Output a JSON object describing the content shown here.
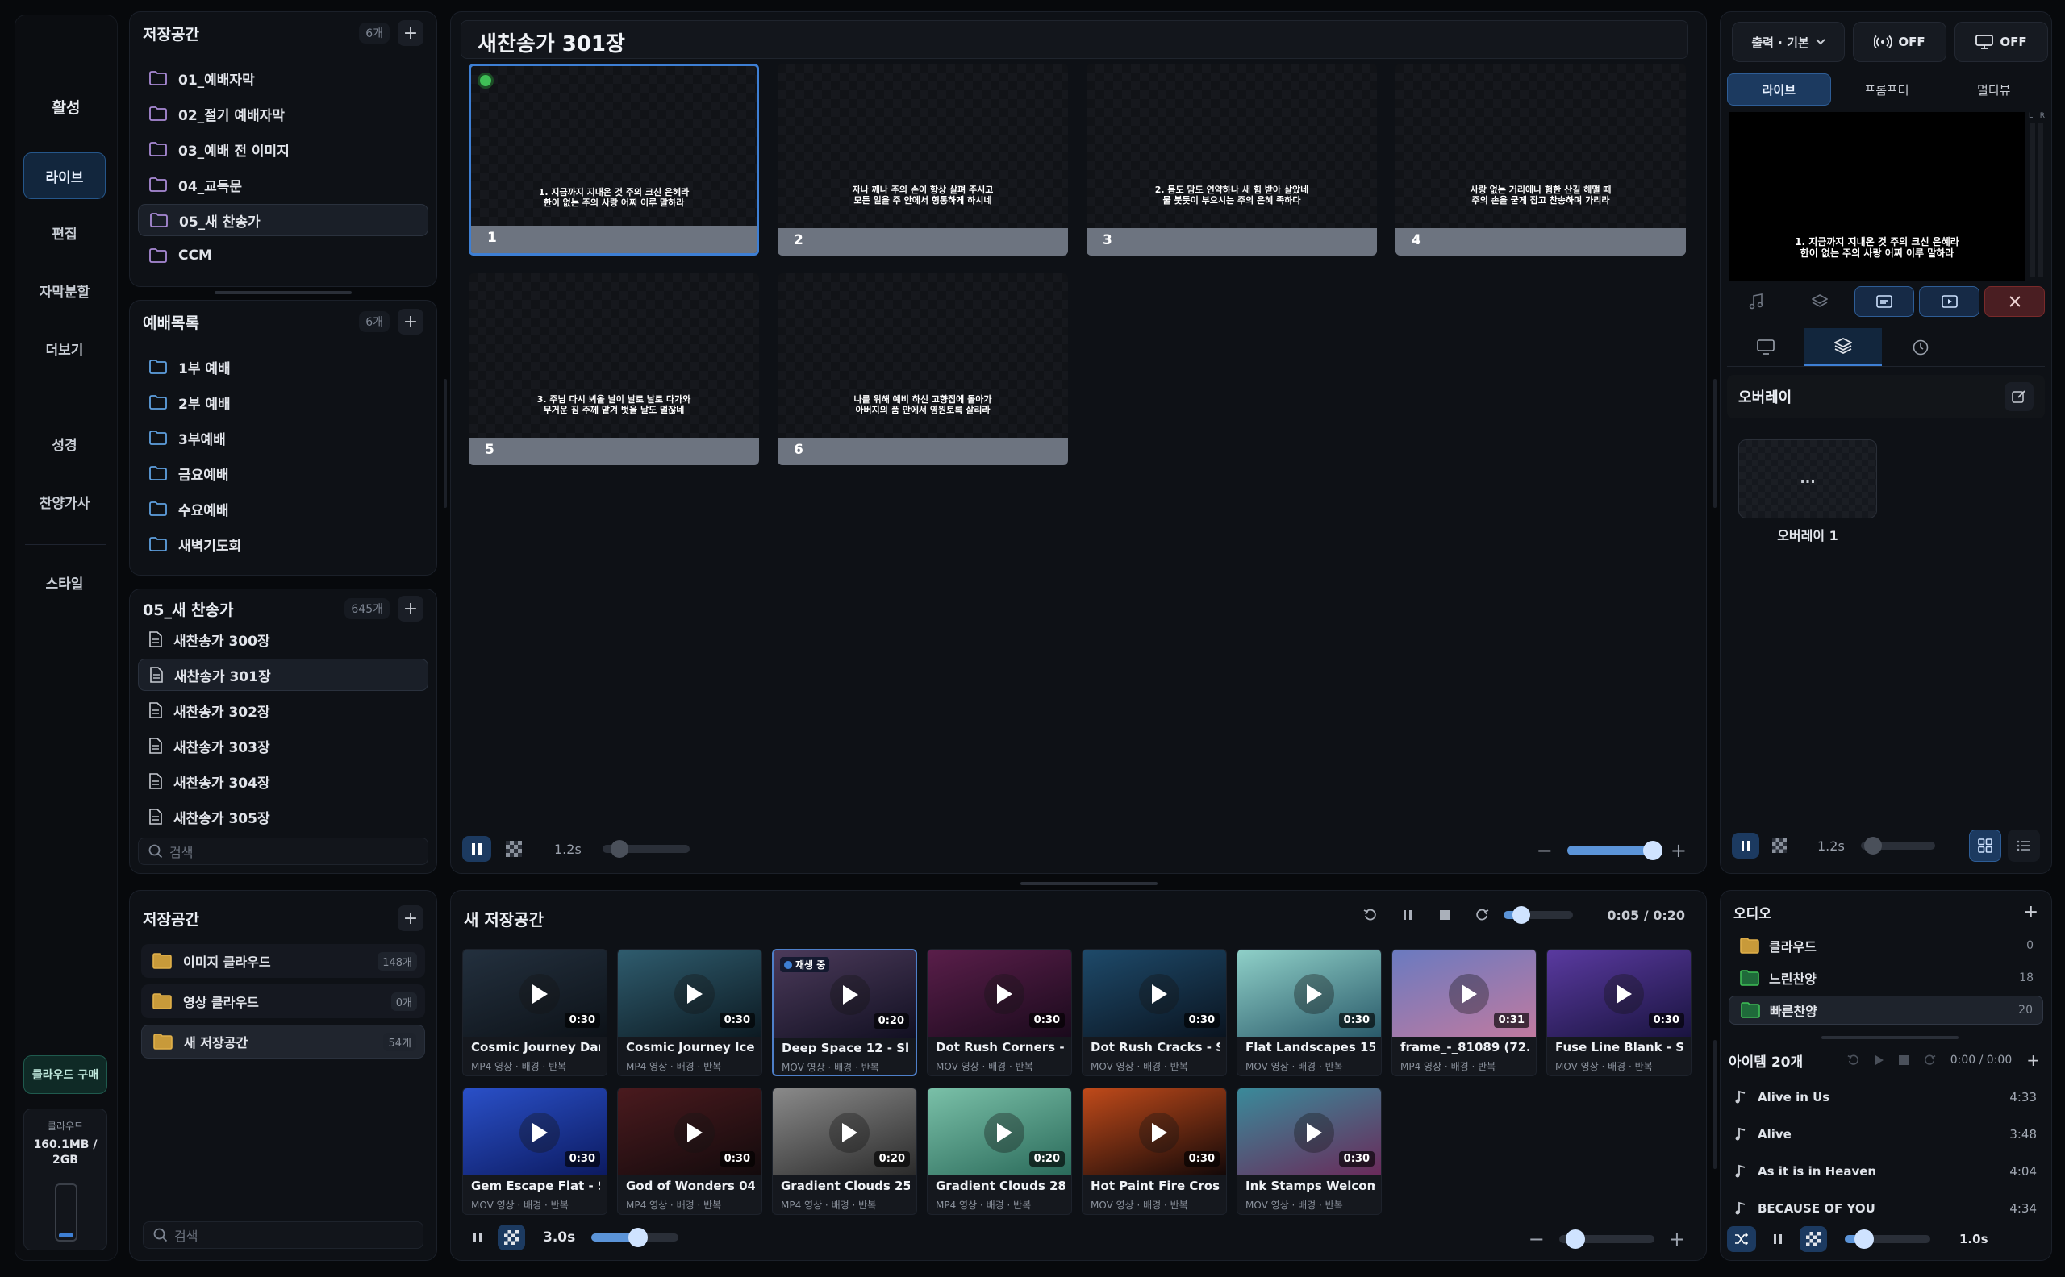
{
  "nav": {
    "section_title": "활성",
    "items": [
      "라이브",
      "편집",
      "자막분할",
      "더보기",
      "성경",
      "찬양가사",
      "스타일"
    ],
    "cloud_buy": "클라우드 구매",
    "cloud_usage_label": "클라우드",
    "cloud_usage_value": "160.1MB / 2GB",
    "cloud_fill": 0.08
  },
  "storage": {
    "title": "저장공간",
    "count": "6개",
    "folders": [
      "01_예배자막",
      "02_절기 예배자막",
      "03_예배 전 이미지",
      "04_교독문",
      "05_새 찬송가",
      "CCM"
    ],
    "selected": 4
  },
  "services": {
    "title": "예배목록",
    "count": "6개",
    "folders": [
      "1부 예배",
      "2부 예배",
      "3부예배",
      "금요예배",
      "수요예배",
      "새벽기도회"
    ]
  },
  "hymns": {
    "title": "05_새 찬송가",
    "count": "645개",
    "items": [
      "새찬송가 300장",
      "새찬송가 301장",
      "새찬송가 302장",
      "새찬송가 303장",
      "새찬송가 304장",
      "새찬송가 305장"
    ],
    "selected": 1,
    "search_placeholder": "검색"
  },
  "media_storage": {
    "title": "저장공간",
    "items": [
      {
        "name": "이미지 클라우드",
        "count": "148개"
      },
      {
        "name": "영상 클라우드",
        "count": "0개"
      },
      {
        "name": "새 저장공간",
        "count": "54개"
      }
    ],
    "selected": 2,
    "search_placeholder": "검색"
  },
  "editor": {
    "title": "새찬송가 301장",
    "slides": [
      {
        "num": "1",
        "line1": "1. 지금까지 지내온 것 주의 크신 은혜라",
        "line2": "한이 없는 주의 사랑 어찌 이루 말하라"
      },
      {
        "num": "2",
        "line1": "자나 깨나 주의 손이 항상 살펴 주시고",
        "line2": "모든 일을 주 안에서 형통하게 하시네"
      },
      {
        "num": "3",
        "line1": "2. 몸도 맘도 연약하나 새 힘 받아 살았네",
        "line2": "물 붓듯이 부으시는 주의 은혜 족하다"
      },
      {
        "num": "4",
        "line1": "사랑 없는 거리에나 험한 산길 헤맬 때",
        "line2": "주의 손을 굳게 잡고 찬송하며 가리라"
      },
      {
        "num": "5",
        "line1": "3. 주님 다시 뵈올 날이 날로 날로 다가와",
        "line2": "무거운 짐 주께 맡겨 벗을 날도 멀잖네"
      },
      {
        "num": "6",
        "line1": "나를 위해 예비 하신 고향집에 돌아가",
        "line2": "아버지의 품 안에서 영원토록 살리라"
      }
    ],
    "interval": "1.2s"
  },
  "media": {
    "title": "새 저장공간",
    "time": "0:05 / 0:20",
    "interval": "3.0s",
    "playing_badge": "재생 중",
    "items": [
      {
        "name": "Cosmic Journey Dar…",
        "meta": "MP4 영상 · 배경 · 반복",
        "dur": "0:30",
        "c1": "#23303e",
        "c2": "#0d1218"
      },
      {
        "name": "Cosmic Journey Ice …",
        "meta": "MP4 영상 · 배경 · 반복",
        "dur": "0:30",
        "c1": "#2f5c6e",
        "c2": "#0c1a22"
      },
      {
        "name": "Deep Space 12 - Slo…",
        "meta": "MOV 영상 · 배경 · 반복",
        "dur": "0:20",
        "c1": "#4b3a5a",
        "c2": "#121022"
      },
      {
        "name": "Dot Rush Corners - …",
        "meta": "MOV 영상 · 배경 · 반복",
        "dur": "0:30",
        "c1": "#5a1e4a",
        "c2": "#1a0a1c"
      },
      {
        "name": "Dot Rush Cracks - S…",
        "meta": "MOV 영상 · 배경 · 반복",
        "dur": "0:30",
        "c1": "#1e4a6a",
        "c2": "#0a1420"
      },
      {
        "name": "Flat Landscapes 15 …",
        "meta": "MOV 영상 · 배경 · 반복",
        "dur": "0:30",
        "c1": "#8fd0c8",
        "c2": "#2a5a6a"
      },
      {
        "name": "frame_-_81089 (72…",
        "meta": "MP4 영상 · 배경 · 반복",
        "dur": "0:31",
        "c1": "#6a7ac0",
        "c2": "#c07aa0"
      },
      {
        "name": "Fuse Line Blank - Sl…",
        "meta": "MOV 영상 · 배경 · 반복",
        "dur": "0:30",
        "c1": "#5a3aa0",
        "c2": "#1a1440"
      },
      {
        "name": "Gem Escape Flat - S…",
        "meta": "MOV 영상 · 배경 · 반복",
        "dur": "0:30",
        "c1": "#2a50c8",
        "c2": "#0c1a60"
      },
      {
        "name": "God of Wonders 04…",
        "meta": "MP4 영상 · 배경 · 반복",
        "dur": "0:30",
        "c1": "#4a1a1e",
        "c2": "#120a0c"
      },
      {
        "name": "Gradient Clouds 25 …",
        "meta": "MP4 영상 · 배경 · 반복",
        "dur": "0:20",
        "c1": "#8a8a8a",
        "c2": "#2a2a2a"
      },
      {
        "name": "Gradient Clouds 28 …",
        "meta": "MP4 영상 · 배경 · 반복",
        "dur": "0:20",
        "c1": "#7ac0a8",
        "c2": "#2a6a5a"
      },
      {
        "name": "Hot Paint Fire Cross…",
        "meta": "MOV 영상 · 배경 · 반복",
        "dur": "0:30",
        "c1": "#c04a1a",
        "c2": "#120808"
      },
      {
        "name": "Ink Stamps Welcom…",
        "meta": "MOV 영상 · 배경 · 반복",
        "dur": "0:30",
        "c1": "#3a8a9a",
        "c2": "#6a2a5a"
      }
    ]
  },
  "output": {
    "output_label": "출력 · 기본",
    "broadcast_state": "OFF",
    "display_state": "OFF",
    "tabs": [
      "라이브",
      "프롬프터",
      "멀티뷰"
    ],
    "preview_line1": "1. 지금까지 지내온 것 주의 크신 은혜라",
    "preview_line2": "한이 없는 주의 사랑 어찌 이루 말하라",
    "meter_labels": [
      "L",
      "R"
    ],
    "overlay_title": "오버레이",
    "overlay_item": "오버레이 1",
    "overlay_thumb_text": "...",
    "interval": "1.2s"
  },
  "audio": {
    "title": "오디오",
    "folders": [
      {
        "name": "클라우드",
        "count": "0"
      },
      {
        "name": "느린찬양",
        "count": "18"
      },
      {
        "name": "빠른찬양",
        "count": "20"
      }
    ],
    "selected": 2,
    "items_label": "아이템 20개",
    "time": "0:00 / 0:00",
    "songs": [
      {
        "name": "Alive in Us",
        "dur": "4:33"
      },
      {
        "name": "Alive",
        "dur": "3:48"
      },
      {
        "name": "As it is in Heaven",
        "dur": "4:04"
      },
      {
        "name": "BECAUSE OF YOU",
        "dur": "4:34"
      }
    ],
    "interval": "1.0s"
  },
  "colors": {
    "accent": "#3e7fd4",
    "live": "#3fbf56",
    "close": "#7a2a2a"
  }
}
